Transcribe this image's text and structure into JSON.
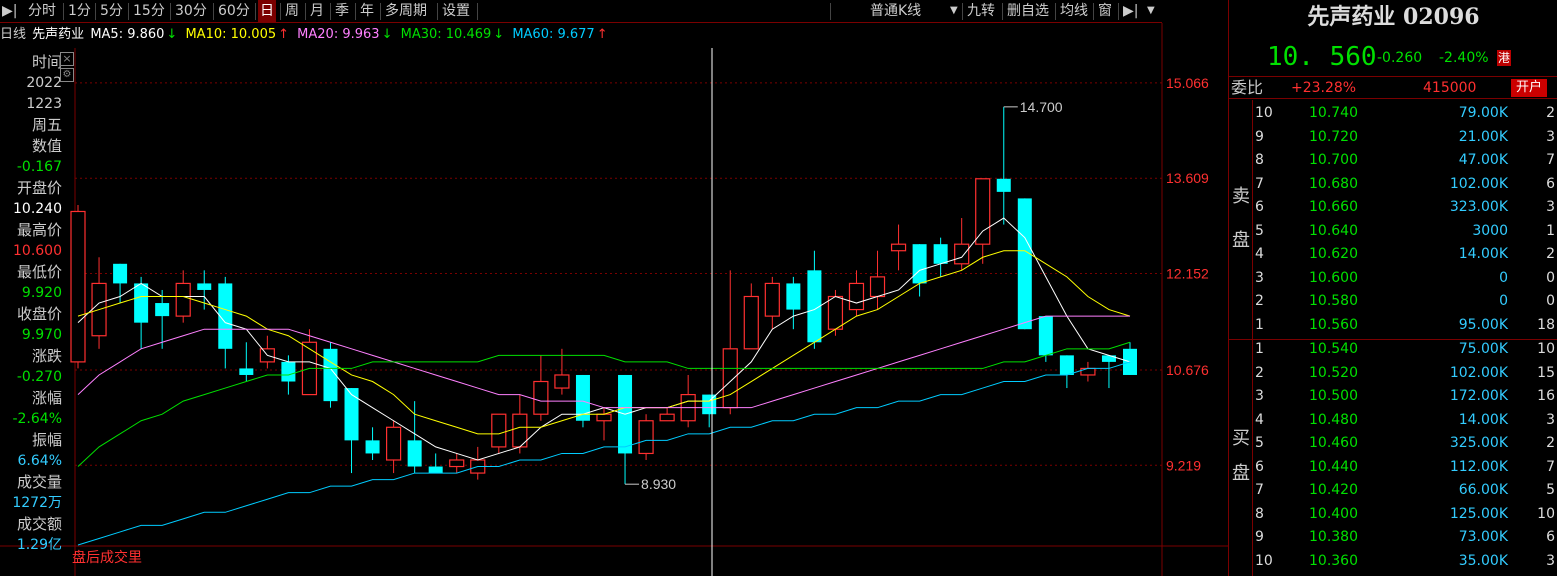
{
  "toolbar": {
    "items": [
      "分时",
      "1分",
      "5分",
      "15分",
      "30分",
      "60分",
      "日",
      "周",
      "月",
      "季",
      "年",
      "多周期",
      "设置"
    ],
    "active": "日",
    "right_items": [
      "普通K线",
      "九转",
      "删自选",
      "均线",
      "窗"
    ]
  },
  "ma_bar": {
    "period": "日线",
    "name": "先声药业",
    "ma5": "MA5: 9.860",
    "ma10": "MA10: 10.005",
    "ma20": "MA20: 9.963",
    "ma30": "MA30: 10.469",
    "ma60": "MA60: 9.677",
    "arrows": [
      "↓",
      "↑",
      "↓",
      "↓",
      "↑"
    ]
  },
  "info_panel": [
    {
      "label": "时间",
      "value": "2022"
    },
    {
      "label": "",
      "value": "1223"
    },
    {
      "label": "周五",
      "value": ""
    },
    {
      "label": "数值",
      "value": "-0.167"
    },
    {
      "label": "开盘价",
      "value": "10.240"
    },
    {
      "label": "最高价",
      "value": "10.600"
    },
    {
      "label": "最低价",
      "value": "9.920"
    },
    {
      "label": "收盘价",
      "value": "9.970"
    },
    {
      "label": "涨跌",
      "value": "-0.270"
    },
    {
      "label": "涨幅",
      "value": "-2.64%"
    },
    {
      "label": "振幅",
      "value": "6.64%"
    },
    {
      "label": "成交量",
      "value": "1272万"
    },
    {
      "label": "成交额",
      "value": "1.29亿"
    }
  ],
  "bottom_label": "盘后成交里",
  "colors": {
    "up": "#ff3030",
    "down": "#00ffff",
    "ma5": "#ffffff",
    "ma10": "#ffff00",
    "ma20": "#ff80ff",
    "ma30": "#00e000",
    "ma60": "#00ccff",
    "grid": "#7a0000",
    "axis": "#ff3030"
  },
  "chart_data": {
    "type": "candlestick",
    "y_ticks": [
      "15.066",
      "13.609",
      "12.152",
      "10.676",
      "9.219"
    ],
    "ylim": [
      8.0,
      15.6
    ],
    "max_label": "14.700",
    "min_label": "8.930",
    "candles": [
      {
        "o": 10.8,
        "c": 13.1,
        "h": 13.2,
        "l": 10.7
      },
      {
        "o": 11.2,
        "c": 12.0,
        "h": 12.4,
        "l": 11.0
      },
      {
        "o": 12.3,
        "c": 12.0,
        "h": 12.3,
        "l": 11.7
      },
      {
        "o": 12.0,
        "c": 11.4,
        "h": 12.1,
        "l": 11.0
      },
      {
        "o": 11.7,
        "c": 11.5,
        "h": 11.9,
        "l": 11.0
      },
      {
        "o": 11.5,
        "c": 12.0,
        "h": 12.2,
        "l": 11.4
      },
      {
        "o": 12.0,
        "c": 11.9,
        "h": 12.2,
        "l": 11.6
      },
      {
        "o": 12.0,
        "c": 11.0,
        "h": 12.1,
        "l": 10.7
      },
      {
        "o": 10.7,
        "c": 10.6,
        "h": 11.1,
        "l": 10.5
      },
      {
        "o": 10.8,
        "c": 11.0,
        "h": 11.2,
        "l": 10.7
      },
      {
        "o": 10.8,
        "c": 10.5,
        "h": 10.9,
        "l": 10.3
      },
      {
        "o": 10.3,
        "c": 11.1,
        "h": 11.3,
        "l": 10.3
      },
      {
        "o": 11.0,
        "c": 10.2,
        "h": 11.1,
        "l": 10.1
      },
      {
        "o": 10.4,
        "c": 9.6,
        "h": 10.4,
        "l": 9.1
      },
      {
        "o": 9.6,
        "c": 9.4,
        "h": 9.8,
        "l": 9.3
      },
      {
        "o": 9.3,
        "c": 9.8,
        "h": 9.9,
        "l": 9.1
      },
      {
        "o": 9.6,
        "c": 9.2,
        "h": 10.2,
        "l": 9.1
      },
      {
        "o": 9.2,
        "c": 9.1,
        "h": 9.4,
        "l": 9.1
      },
      {
        "o": 9.2,
        "c": 9.3,
        "h": 9.4,
        "l": 9.1
      },
      {
        "o": 9.1,
        "c": 9.3,
        "h": 9.5,
        "l": 9.0
      },
      {
        "o": 9.5,
        "c": 10.0,
        "h": 10.0,
        "l": 9.4
      },
      {
        "o": 9.5,
        "c": 10.0,
        "h": 10.3,
        "l": 9.4
      },
      {
        "o": 10.0,
        "c": 10.5,
        "h": 10.9,
        "l": 9.9
      },
      {
        "o": 10.4,
        "c": 10.6,
        "h": 11.0,
        "l": 10.3
      },
      {
        "o": 10.6,
        "c": 9.9,
        "h": 10.6,
        "l": 9.8
      },
      {
        "o": 9.9,
        "c": 10.0,
        "h": 10.1,
        "l": 9.6
      },
      {
        "o": 10.6,
        "c": 9.4,
        "h": 10.6,
        "l": 8.93
      },
      {
        "o": 9.4,
        "c": 9.9,
        "h": 10.0,
        "l": 9.3
      },
      {
        "o": 9.9,
        "c": 10.0,
        "h": 10.1,
        "l": 9.9
      },
      {
        "o": 9.9,
        "c": 10.3,
        "h": 10.6,
        "l": 9.8
      },
      {
        "o": 10.3,
        "c": 10.0,
        "h": 10.3,
        "l": 9.8
      },
      {
        "o": 10.1,
        "c": 11.0,
        "h": 12.2,
        "l": 10.0
      },
      {
        "o": 11.0,
        "c": 11.8,
        "h": 12.0,
        "l": 11.0
      },
      {
        "o": 11.5,
        "c": 12.0,
        "h": 12.1,
        "l": 11.3
      },
      {
        "o": 12.0,
        "c": 11.6,
        "h": 12.1,
        "l": 11.3
      },
      {
        "o": 12.2,
        "c": 11.1,
        "h": 12.5,
        "l": 11.0
      },
      {
        "o": 11.3,
        "c": 11.8,
        "h": 11.9,
        "l": 11.2
      },
      {
        "o": 11.6,
        "c": 12.0,
        "h": 12.2,
        "l": 11.5
      },
      {
        "o": 11.8,
        "c": 12.1,
        "h": 12.5,
        "l": 11.6
      },
      {
        "o": 12.5,
        "c": 12.6,
        "h": 12.9,
        "l": 12.2
      },
      {
        "o": 12.6,
        "c": 12.0,
        "h": 12.6,
        "l": 11.8
      },
      {
        "o": 12.6,
        "c": 12.3,
        "h": 12.7,
        "l": 12.1
      },
      {
        "o": 12.3,
        "c": 12.6,
        "h": 13.0,
        "l": 12.2
      },
      {
        "o": 12.6,
        "c": 13.6,
        "h": 13.6,
        "l": 12.3
      },
      {
        "o": 13.6,
        "c": 13.4,
        "h": 14.7,
        "l": 12.9
      },
      {
        "o": 13.3,
        "c": 11.3,
        "h": 13.3,
        "l": 11.3
      },
      {
        "o": 11.5,
        "c": 10.9,
        "h": 11.5,
        "l": 10.8
      },
      {
        "o": 10.9,
        "c": 10.6,
        "h": 10.9,
        "l": 10.4
      },
      {
        "o": 10.6,
        "c": 10.7,
        "h": 10.8,
        "l": 10.5
      },
      {
        "o": 10.9,
        "c": 10.8,
        "h": 10.9,
        "l": 10.4
      },
      {
        "o": 11.0,
        "c": 10.6,
        "h": 11.1,
        "l": 10.6
      }
    ],
    "ma_series": [
      {
        "name": "MA5",
        "values": [
          11.4,
          11.7,
          11.8,
          12.0,
          11.8,
          11.8,
          11.8,
          11.4,
          11.3,
          10.9,
          10.8,
          10.8,
          10.7,
          10.3,
          10.1,
          9.9,
          9.7,
          9.5,
          9.4,
          9.3,
          9.4,
          9.5,
          9.8,
          10.0,
          10.0,
          10.1,
          10.0,
          10.1,
          10.1,
          10.2,
          10.2,
          10.5,
          10.8,
          11.3,
          11.5,
          11.6,
          11.8,
          11.7,
          11.8,
          11.9,
          12.2,
          12.3,
          12.4,
          12.8,
          13.0,
          12.7,
          12.1,
          11.5,
          11.0,
          10.9,
          10.8
        ]
      },
      {
        "name": "MA10",
        "values": [
          11.5,
          11.6,
          11.7,
          11.8,
          11.8,
          11.8,
          11.7,
          11.6,
          11.5,
          11.3,
          11.2,
          11.0,
          10.8,
          10.6,
          10.5,
          10.3,
          10.0,
          9.9,
          9.8,
          9.7,
          9.7,
          9.8,
          9.8,
          9.9,
          10.0,
          10.0,
          10.1,
          10.1,
          10.1,
          10.2,
          10.2,
          10.3,
          10.5,
          10.7,
          10.9,
          11.1,
          11.3,
          11.5,
          11.6,
          11.8,
          12.0,
          12.1,
          12.2,
          12.4,
          12.5,
          12.5,
          12.3,
          12.1,
          11.8,
          11.6,
          11.5
        ]
      },
      {
        "name": "MA20",
        "values": [
          10.3,
          10.6,
          10.8,
          11.0,
          11.1,
          11.2,
          11.3,
          11.3,
          11.3,
          11.3,
          11.3,
          11.2,
          11.1,
          11.0,
          10.9,
          10.8,
          10.7,
          10.6,
          10.5,
          10.4,
          10.3,
          10.3,
          10.2,
          10.2,
          10.2,
          10.1,
          10.1,
          10.1,
          10.1,
          10.1,
          10.1,
          10.1,
          10.1,
          10.2,
          10.3,
          10.4,
          10.5,
          10.6,
          10.7,
          10.8,
          10.9,
          11.0,
          11.1,
          11.2,
          11.3,
          11.4,
          11.5,
          11.5,
          11.5,
          11.5,
          11.5
        ]
      },
      {
        "name": "MA30",
        "values": [
          9.2,
          9.5,
          9.7,
          9.9,
          10.0,
          10.2,
          10.3,
          10.4,
          10.5,
          10.6,
          10.6,
          10.7,
          10.7,
          10.7,
          10.8,
          10.8,
          10.8,
          10.8,
          10.8,
          10.8,
          10.9,
          10.9,
          10.9,
          10.9,
          10.9,
          10.9,
          10.8,
          10.8,
          10.8,
          10.7,
          10.7,
          10.7,
          10.7,
          10.7,
          10.7,
          10.7,
          10.7,
          10.7,
          10.7,
          10.7,
          10.7,
          10.7,
          10.7,
          10.7,
          10.8,
          10.8,
          10.9,
          11.0,
          11.0,
          11.0,
          11.1
        ]
      },
      {
        "name": "MA60",
        "values": [
          8.0,
          8.1,
          8.2,
          8.3,
          8.3,
          8.4,
          8.5,
          8.5,
          8.6,
          8.7,
          8.8,
          8.8,
          8.9,
          8.9,
          9.0,
          9.0,
          9.1,
          9.1,
          9.1,
          9.2,
          9.2,
          9.3,
          9.3,
          9.4,
          9.4,
          9.5,
          9.5,
          9.6,
          9.6,
          9.7,
          9.7,
          9.8,
          9.8,
          9.9,
          9.9,
          10.0,
          10.0,
          10.1,
          10.1,
          10.2,
          10.2,
          10.3,
          10.3,
          10.4,
          10.5,
          10.5,
          10.6,
          10.6,
          10.7,
          10.7,
          10.8
        ]
      }
    ]
  },
  "order_book": {
    "title": "先声药业 02096",
    "price": "10. 560",
    "change": "-0.260",
    "change_pct": "-2.40%",
    "hk_badge": "港",
    "wei_label": "委比",
    "wei_pct": "+23.28%",
    "wei_vol": "415000",
    "open_btn": "开户",
    "sell_label": [
      "卖",
      "盘"
    ],
    "buy_label": [
      "买",
      "盘"
    ],
    "asks": [
      {
        "lvl": "10",
        "price": "10.740",
        "vol": "79.00K",
        "orders": "2"
      },
      {
        "lvl": "9",
        "price": "10.720",
        "vol": "21.00K",
        "orders": "3"
      },
      {
        "lvl": "8",
        "price": "10.700",
        "vol": "47.00K",
        "orders": "7"
      },
      {
        "lvl": "7",
        "price": "10.680",
        "vol": "102.00K",
        "orders": "6"
      },
      {
        "lvl": "6",
        "price": "10.660",
        "vol": "323.00K",
        "orders": "3"
      },
      {
        "lvl": "5",
        "price": "10.640",
        "vol": "3000",
        "orders": "1"
      },
      {
        "lvl": "4",
        "price": "10.620",
        "vol": "14.00K",
        "orders": "2"
      },
      {
        "lvl": "3",
        "price": "10.600",
        "vol": "0",
        "orders": "0"
      },
      {
        "lvl": "2",
        "price": "10.580",
        "vol": "0",
        "orders": "0"
      },
      {
        "lvl": "1",
        "price": "10.560",
        "vol": "95.00K",
        "orders": "18"
      }
    ],
    "bids": [
      {
        "lvl": "1",
        "price": "10.540",
        "vol": "75.00K",
        "orders": "10"
      },
      {
        "lvl": "2",
        "price": "10.520",
        "vol": "102.00K",
        "orders": "15"
      },
      {
        "lvl": "3",
        "price": "10.500",
        "vol": "172.00K",
        "orders": "16"
      },
      {
        "lvl": "4",
        "price": "10.480",
        "vol": "14.00K",
        "orders": "3"
      },
      {
        "lvl": "5",
        "price": "10.460",
        "vol": "325.00K",
        "orders": "2"
      },
      {
        "lvl": "6",
        "price": "10.440",
        "vol": "112.00K",
        "orders": "7"
      },
      {
        "lvl": "7",
        "price": "10.420",
        "vol": "66.00K",
        "orders": "5"
      },
      {
        "lvl": "8",
        "price": "10.400",
        "vol": "125.00K",
        "orders": "10"
      },
      {
        "lvl": "9",
        "price": "10.380",
        "vol": "73.00K",
        "orders": "6"
      },
      {
        "lvl": "10",
        "price": "10.360",
        "vol": "35.00K",
        "orders": "3"
      }
    ]
  }
}
